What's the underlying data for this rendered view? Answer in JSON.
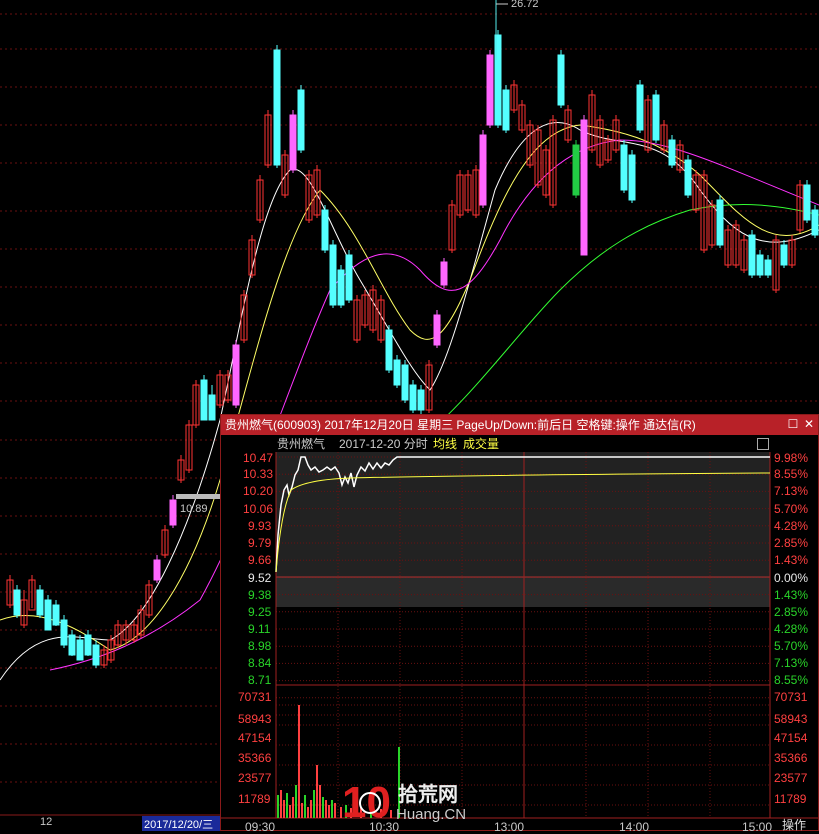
{
  "kline": {
    "price_tag": "10.89",
    "peak_label": "26.72",
    "date_left": "12",
    "date_right": "2017/12/20/三"
  },
  "popup": {
    "title": "贵州燃气(600903) 2017年12月20日 星期三 PageUp/Down:前后日 空格键:操作 通达信(R)",
    "stock_name": "贵州燃气",
    "date": "2017-12-20 分时",
    "avg_label": "均线",
    "vol_label": "成交量",
    "prices_up": [
      "10.47",
      "10.33",
      "10.20",
      "10.06",
      "9.93",
      "9.79",
      "9.66"
    ],
    "price_mid": "9.52",
    "prices_down": [
      "9.38",
      "9.25",
      "9.11",
      "8.98",
      "8.84",
      "8.71"
    ],
    "pct_up": [
      "9.98%",
      "8.55%",
      "7.13%",
      "5.70%",
      "4.28%",
      "2.85%",
      "1.43%"
    ],
    "pct_mid": "0.00%",
    "pct_down": [
      "1.43%",
      "2.85%",
      "4.28%",
      "5.70%",
      "7.13%",
      "8.55%"
    ],
    "vol_ticks": [
      "70731",
      "58943",
      "47154",
      "35366",
      "23577",
      "11789"
    ],
    "times": [
      "09:30",
      "10:30",
      "13:00",
      "14:00",
      "15:00"
    ]
  },
  "bottom": {
    "operate": "操作"
  },
  "watermark": {
    "num": "10",
    "cn": "拾荒网",
    "en": "Huang.CN"
  },
  "colors": {
    "up": "#ff3333",
    "down": "#54ffff",
    "pink": "#ff66ff",
    "ma5": "#ffffff",
    "ma10": "#ffff66",
    "ma20": "#ff33ff",
    "ma60": "#33ff33"
  }
}
